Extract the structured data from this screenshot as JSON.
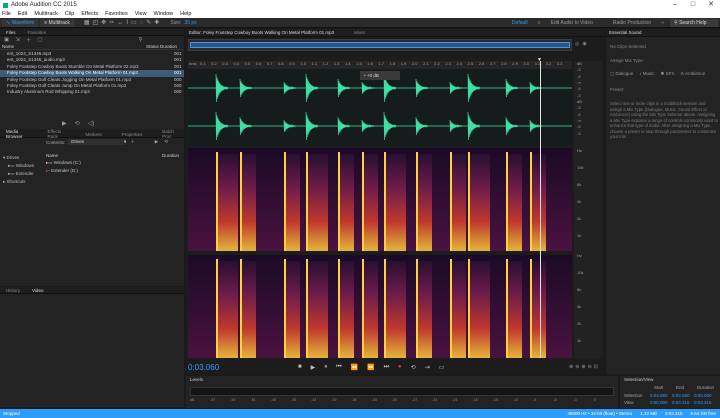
{
  "app": {
    "title": "Adobe Audition CC 2015"
  },
  "window_controls": [
    "–",
    "□",
    "✕"
  ],
  "menu": [
    "File",
    "Edit",
    "Multitrack",
    "Clip",
    "Effects",
    "Favorites",
    "View",
    "Window",
    "Help"
  ],
  "toolbar": {
    "waveform": "Waveform",
    "multitrack": "Multitrack",
    "size_label": "Size:",
    "size_value": "30 px",
    "workspaces": [
      "Default",
      "Edit Audio to Video",
      "Radio Production"
    ],
    "search_placeholder": "Search Help"
  },
  "files_panel": {
    "tabs": [
      "Files",
      "Favorites"
    ],
    "columns": {
      "name": "Name",
      "status": "Status",
      "duration": "Duration"
    },
    "items": [
      {
        "name": "ent_1024_S1346.mp3",
        "duration": "001"
      },
      {
        "name": "ent_1024_S1346_audio.mp3",
        "duration": "001"
      },
      {
        "name": "Foley Footstep Cowboy Boots Stumble On Metal Platform 02.mp3",
        "duration": "001"
      },
      {
        "name": "Foley Footstep Cowboy Boots Walking On Metal Platform 01.mp3",
        "duration": "001",
        "selected": true
      },
      {
        "name": "Foley Footstep Golf Cleats Jogging On Metal Platform 01.mp3",
        "duration": "000"
      },
      {
        "name": "Foley Footstep Golf Cleats Jump On Metal Platform 01.mp3",
        "duration": "000"
      },
      {
        "name": "Industry Aluminum Rod Whipping 01.mp3",
        "duration": "000"
      }
    ]
  },
  "media_browser": {
    "tabs": [
      "Media Browser",
      "Effects Rack",
      "Markers",
      "Properties",
      "Batch Proc"
    ],
    "contents_label": "Contents:",
    "contents_value": "Drives",
    "tree": [
      "Drives",
      "Windows",
      "Extender",
      "Shortcuts"
    ],
    "columns": {
      "name": "Name",
      "duration": "Duration"
    },
    "items": [
      "Windows (C:)",
      "Extender (D:)"
    ]
  },
  "history_tabs": [
    "History",
    "Video"
  ],
  "editor": {
    "tab_title": "Editor: Foley Footstep Cowboy Boots Walking On Metal Platform 01.mp3",
    "mixer_tab": "Mixer",
    "hms_label": "hms",
    "time_ticks": [
      "0.1",
      "0.2",
      "0.3",
      "0.4",
      "0.5",
      "0.6",
      "0.7",
      "0.8",
      "0.9",
      "1.0",
      "1.1",
      "1.2",
      "1.3",
      "1.4",
      "1.5",
      "1.6",
      "1.7",
      "1.8",
      "1.9",
      "2.0",
      "2.1",
      "2.2",
      "2.3",
      "2.4",
      "2.5",
      "2.6",
      "2.7",
      "2.8",
      "2.9",
      "3.0",
      "3.1",
      "3.2",
      "3.3"
    ],
    "amp_labels": [
      "dB",
      "-3",
      "-9",
      "-∞",
      "-9",
      "-3",
      "dB",
      "-3",
      "-9",
      "-∞",
      "-9",
      "-3"
    ],
    "freq_labels": [
      "Hz",
      "10k",
      "6k",
      "4k",
      "2k",
      "1k",
      "Hz",
      "10k",
      "6k",
      "4k",
      "2k",
      "1k"
    ],
    "hud_value": "+0 dB",
    "current_time": "0:03.060",
    "transport": [
      "■",
      "▶",
      "⏸",
      "⏮",
      "⏪",
      "⏩",
      "⏭",
      "●",
      "⟲",
      "⇥",
      "▭"
    ]
  },
  "levels": {
    "label": "Levels",
    "scale": [
      "dB",
      "-57",
      "-54",
      "-51",
      "-48",
      "-45",
      "-42",
      "-39",
      "-36",
      "-33",
      "-30",
      "-27",
      "-24",
      "-21",
      "-18",
      "-15",
      "-12",
      "-9",
      "-6",
      "-3",
      "0"
    ]
  },
  "essential_sound": {
    "title": "Essential Sound",
    "no_clips": "No Clips Selected",
    "assign_label": "Assign Mix Type:",
    "types": [
      "Dialogue",
      "Music",
      "SFX",
      "Ambience"
    ],
    "preset_label": "Preset:",
    "description": "Select one or more clips in a multitrack session and assign a Mix Type (Dialogue, Music, Sound Effect or Ambience) using the Mix Type Selector above. Assigning a Mix Type exposes a range of controls commonly used to enhance that type of audio. After assigning a Mix Type, choose a preset or step through parameters to customize your mix."
  },
  "selection_view": {
    "title": "Selection/View",
    "headers": [
      "Start",
      "End",
      "Duration"
    ],
    "rows": [
      {
        "label": "Selection",
        "start": "0:03.060",
        "end": "0:03.060",
        "duration": "0:00.000"
      },
      {
        "label": "View",
        "start": "0:00.000",
        "end": "0:03.315",
        "duration": "0:03.315"
      }
    ]
  },
  "status": {
    "left": "Stopped",
    "right": [
      "48000 Hz • 32-bit (float) • Stereo",
      "1.22 MB",
      "0:03.315",
      "5.64 GB free"
    ]
  },
  "colors": {
    "accent": "#2d9dfc",
    "waveform": "#3fe0a3",
    "selection": "#3e5b77",
    "spectral_hot": "#ffd13a",
    "spectral_mid": "#d6402c",
    "spectral_low": "#2a0f35"
  }
}
